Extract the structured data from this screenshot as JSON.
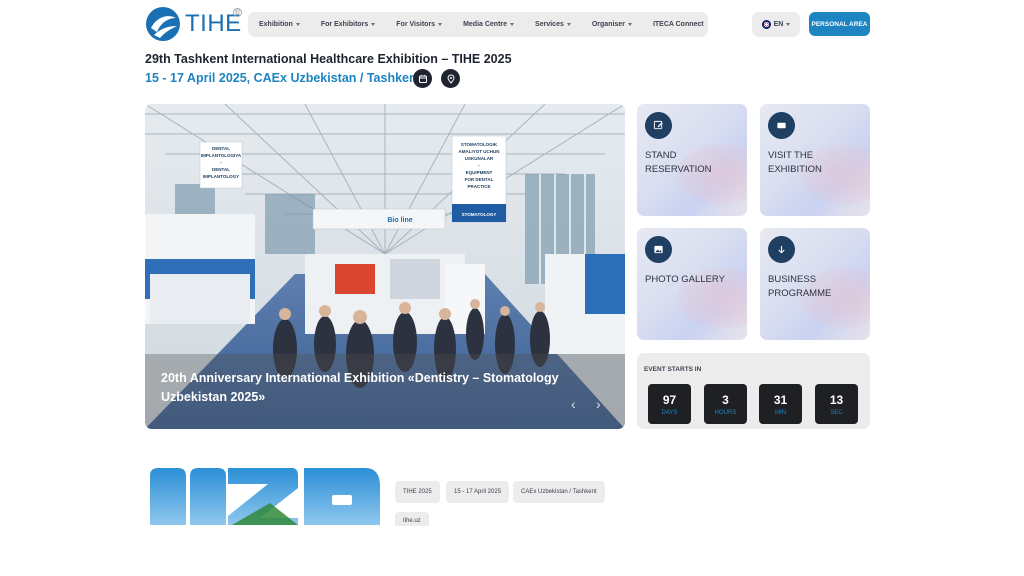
{
  "header": {
    "logo_text": "TIHE",
    "nav": [
      {
        "label": "Exhibition",
        "dropdown": true
      },
      {
        "label": "For Exhibitors",
        "dropdown": true
      },
      {
        "label": "For Visitors",
        "dropdown": true
      },
      {
        "label": "Media Centre",
        "dropdown": true
      },
      {
        "label": "Services",
        "dropdown": true
      },
      {
        "label": "Organiser",
        "dropdown": true
      },
      {
        "label": "ITECA Connect",
        "dropdown": false
      }
    ],
    "language": "EN",
    "personal_area": "PERSONAL AREA"
  },
  "event": {
    "title": "29th Tashkent International Healthcare Exhibition – TIHE 2025",
    "subtitle": "15 - 17 April 2025, CAEx Uzbekistan / Tashkent"
  },
  "hero": {
    "caption": "20th Anniversary International Exhibition «Dentistry – Stomatology Uzbekistan 2025»",
    "banners": {
      "left": [
        "DENTAL",
        "IMPLANTOLOGIYA",
        "-",
        "DENTAL",
        "IMPLANTOLOGY"
      ],
      "right": [
        "STOMATOLOGIK",
        "AMALIYOT UCHUN",
        "USKUNALAR",
        "-",
        "EQUIPMENT",
        "FOR DENTAL",
        "PRACTICE"
      ],
      "right_footer": "STOMATOLOGY",
      "center": "Bio line"
    }
  },
  "cards": [
    {
      "label": "STAND RESERVATION",
      "icon": "edit-icon"
    },
    {
      "label": "VISIT THE EXHIBITION",
      "icon": "ticket-icon"
    },
    {
      "label": "PHOTO GALLERY",
      "icon": "image-icon"
    },
    {
      "label": "BUSINESS PROGRAMME",
      "icon": "arrow-down-icon"
    }
  ],
  "countdown": {
    "title": "EVENT STARTS IN",
    "items": [
      {
        "value": "97",
        "unit": "DAYS"
      },
      {
        "value": "3",
        "unit": "HOURS"
      },
      {
        "value": "31",
        "unit": "MIN"
      },
      {
        "value": "13",
        "unit": "SEC"
      }
    ]
  },
  "tags": [
    "TIHE 2025",
    "15 - 17 April 2025",
    "CAEx Uzbekistan / Tashkent",
    "tihe.uz"
  ],
  "colors": {
    "accent": "#1d84c1",
    "dark": "#1f2430",
    "logo": "#1b6fb3",
    "card_icon": "#1f3f63"
  }
}
